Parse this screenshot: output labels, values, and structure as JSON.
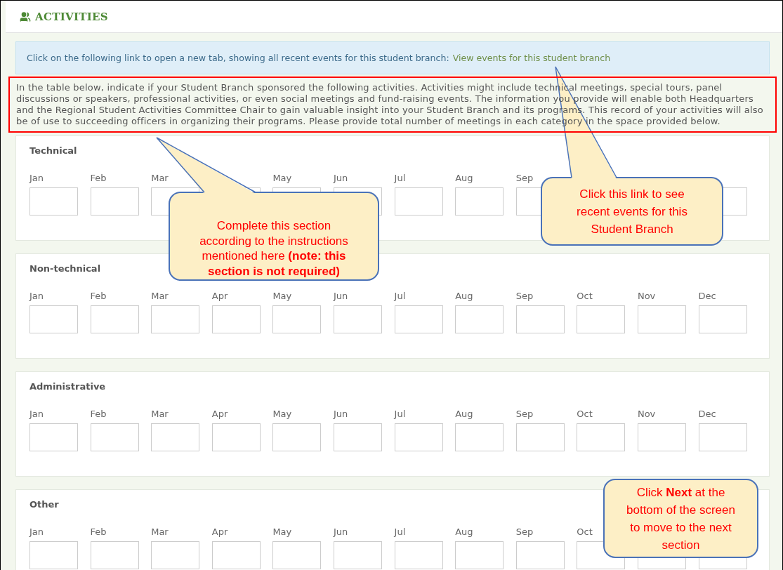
{
  "header": {
    "title": "ACTIVITIES"
  },
  "info": {
    "text": "Click on the following link to open a new tab, showing all recent events for this student branch:",
    "link": "View events for this student branch"
  },
  "instructions": "In the table below, indicate if your Student Branch sponsored the following activities. Activities might include technical meetings, special tours, panel discussions or speakers, professional activities, or even social meetings and fund-raising events. The information you provide will enable both Headquarters and the Regional Student Activities Committee Chair to gain valuable insight into your Student Branch and its programs. This record of your activities will also be of use to succeeding officers in organizing their programs. Please provide total number of meetings in each category in the space provided below.",
  "sections": [
    {
      "title": "Technical",
      "months": [
        {
          "kind": "labeled",
          "label": "Jan"
        },
        {
          "kind": "labeled",
          "label": "Feb"
        },
        {
          "kind": "labeled",
          "label": "Mar"
        },
        {
          "kind": "covered"
        },
        {
          "kind": "labeled",
          "label": "May"
        },
        {
          "kind": "labeled",
          "label": "Jun"
        },
        {
          "kind": "labeled",
          "label": "Jul"
        },
        {
          "kind": "labeled",
          "label": "Aug"
        },
        {
          "kind": "labeled",
          "label": "Sep"
        },
        {
          "kind": "hidden"
        },
        {
          "kind": "hidden"
        },
        {
          "kind": "covered"
        }
      ]
    },
    {
      "title": "Non-technical",
      "months": [
        {
          "kind": "labeled",
          "label": "Jan"
        },
        {
          "kind": "labeled",
          "label": "Feb"
        },
        {
          "kind": "labeled",
          "label": "Mar"
        },
        {
          "kind": "labeled",
          "label": "Apr"
        },
        {
          "kind": "labeled",
          "label": "May"
        },
        {
          "kind": "labeled",
          "label": "Jun"
        },
        {
          "kind": "labeled",
          "label": "Jul"
        },
        {
          "kind": "labeled",
          "label": "Aug"
        },
        {
          "kind": "labeled",
          "label": "Sep"
        },
        {
          "kind": "labeled",
          "label": "Oct"
        },
        {
          "kind": "labeled",
          "label": "Nov"
        },
        {
          "kind": "labeled",
          "label": "Dec"
        }
      ]
    },
    {
      "title": "Administrative",
      "months": [
        {
          "kind": "labeled",
          "label": "Jan"
        },
        {
          "kind": "labeled",
          "label": "Feb"
        },
        {
          "kind": "labeled",
          "label": "Mar"
        },
        {
          "kind": "labeled",
          "label": "Apr"
        },
        {
          "kind": "labeled",
          "label": "May"
        },
        {
          "kind": "labeled",
          "label": "Jun"
        },
        {
          "kind": "labeled",
          "label": "Jul"
        },
        {
          "kind": "labeled",
          "label": "Aug"
        },
        {
          "kind": "labeled",
          "label": "Sep"
        },
        {
          "kind": "labeled",
          "label": "Oct"
        },
        {
          "kind": "labeled",
          "label": "Nov"
        },
        {
          "kind": "labeled",
          "label": "Dec"
        }
      ]
    },
    {
      "title": "Other",
      "months": [
        {
          "kind": "labeled",
          "label": "Jan"
        },
        {
          "kind": "labeled",
          "label": "Feb"
        },
        {
          "kind": "labeled",
          "label": "Mar"
        },
        {
          "kind": "labeled",
          "label": "Apr"
        },
        {
          "kind": "labeled",
          "label": "May"
        },
        {
          "kind": "labeled",
          "label": "Jun"
        },
        {
          "kind": "labeled",
          "label": "Jul"
        },
        {
          "kind": "labeled",
          "label": "Aug"
        },
        {
          "kind": "labeled",
          "label": "Sep"
        },
        {
          "kind": "labeled",
          "label": "Oct"
        },
        {
          "kind": "covered"
        },
        {
          "kind": "covered"
        }
      ]
    }
  ],
  "callouts": [
    {
      "text": "Complete this section according to the instructions mentioned here **(note: this section is not required)**",
      "pointer": true
    },
    {
      "text": "Click this link to see recent events for this Student Branch",
      "pointer": true
    },
    {
      "text": "Click **Next** at the bottom of the screen to move to the next section",
      "pointer": false
    }
  ]
}
